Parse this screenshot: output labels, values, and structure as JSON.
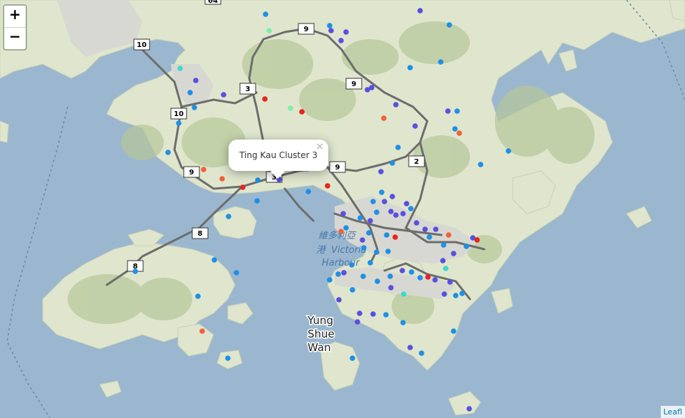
{
  "controls": {
    "zoom_in": "+",
    "zoom_out": "−"
  },
  "popup": {
    "text": "Ting Kau Cluster 3",
    "close": "×"
  },
  "attribution": "Leafl",
  "labels": {
    "yung_shue": "Yung",
    "yung_shue2": "Shue",
    "yung_shue3": "Wan",
    "harbour_cn1": "維多利亞",
    "harbour_cn2": "港",
    "harbour_en1": "Victoria",
    "harbour_en2": "Harbour"
  },
  "route_shields": [
    "10",
    "10",
    "9",
    "9",
    "9",
    "9",
    "3",
    "3",
    "2",
    "8",
    "8",
    "64"
  ],
  "marker_colors": {
    "blue": "#1e90e6",
    "violet": "#5a4fe0",
    "red": "#e8251c",
    "orange": "#f0623a",
    "cyan": "#40d8d0",
    "green": "#7ff0a8"
  }
}
